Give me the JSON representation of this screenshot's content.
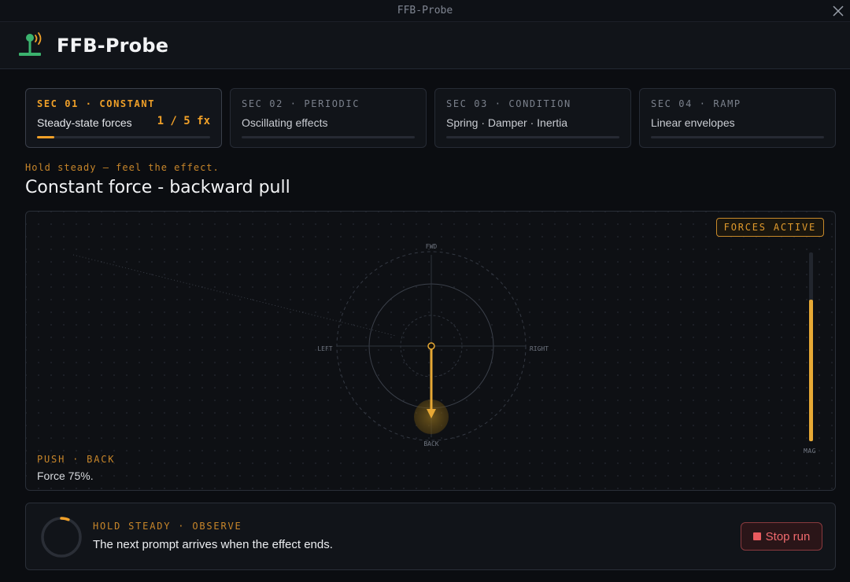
{
  "window": {
    "title": "FFB-Probe"
  },
  "app": {
    "name": "FFB-Probe"
  },
  "sections": [
    {
      "code": "SEC 01 · CONSTANT",
      "description": "Steady-state forces",
      "count": "1 / 5 fx",
      "progress": 0.1,
      "active": true
    },
    {
      "code": "SEC 02 · PERIODIC",
      "description": "Oscillating effects",
      "progress": 0,
      "active": false
    },
    {
      "code": "SEC 03 · CONDITION",
      "description": "Spring · Damper · Inertia",
      "progress": 0,
      "active": false
    },
    {
      "code": "SEC 04 · RAMP",
      "description": "Linear envelopes",
      "progress": 0,
      "active": false
    }
  ],
  "prompt": {
    "subtitle": "Hold steady — feel the effect.",
    "title": "Constant force - backward pull"
  },
  "stage": {
    "badge": "FORCES ACTIVE",
    "axes": {
      "fwd": "FWD",
      "back": "BACK",
      "left": "LEFT",
      "right": "RIGHT"
    },
    "magnitude_label": "MAG",
    "magnitude": 0.75,
    "direction": "back",
    "push_label": "PUSH · BACK",
    "force_text": "Force 75%."
  },
  "status": {
    "label": "HOLD STEADY · OBSERVE",
    "text": "The next prompt arrives when the effect ends.",
    "ring_progress": 0.06,
    "stop_label": "Stop run"
  },
  "colors": {
    "accent": "#f0a028",
    "danger": "#ea5a5e",
    "ok": "#3bb36e"
  }
}
